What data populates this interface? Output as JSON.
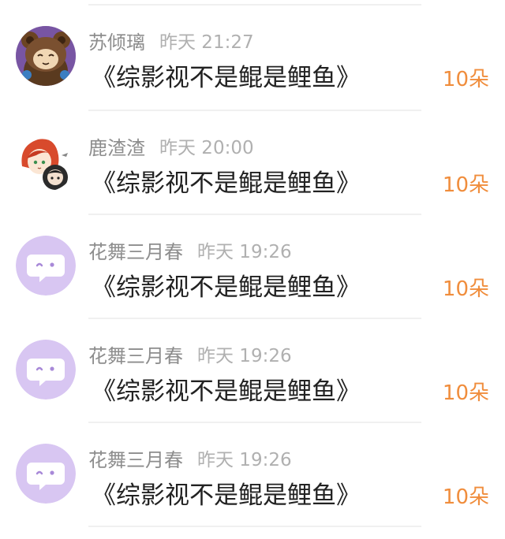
{
  "accent_color": "#f08d3c",
  "entries": [
    {
      "username": "苏倾璃",
      "time": "昨天 21:27",
      "title": "《综影视不是鲲是鲤鱼》",
      "count": "10朵",
      "avatar_icon": "bear-costume-avatar"
    },
    {
      "username": "鹿渣渣",
      "time": "昨天 20:00",
      "title": "《综影视不是鲲是鲤鱼》",
      "count": "10朵",
      "avatar_icon": "chibi-characters-avatar"
    },
    {
      "username": "花舞三月春",
      "time": "昨天 19:26",
      "title": "《综影视不是鲲是鲤鱼》",
      "count": "10朵",
      "avatar_icon": "wink-chat-bubble-avatar"
    },
    {
      "username": "花舞三月春",
      "time": "昨天 19:26",
      "title": "《综影视不是鲲是鲤鱼》",
      "count": "10朵",
      "avatar_icon": "wink-chat-bubble-avatar"
    },
    {
      "username": "花舞三月春",
      "time": "昨天 19:26",
      "title": "《综影视不是鲲是鲤鱼》",
      "count": "10朵",
      "avatar_icon": "wink-chat-bubble-avatar"
    }
  ]
}
